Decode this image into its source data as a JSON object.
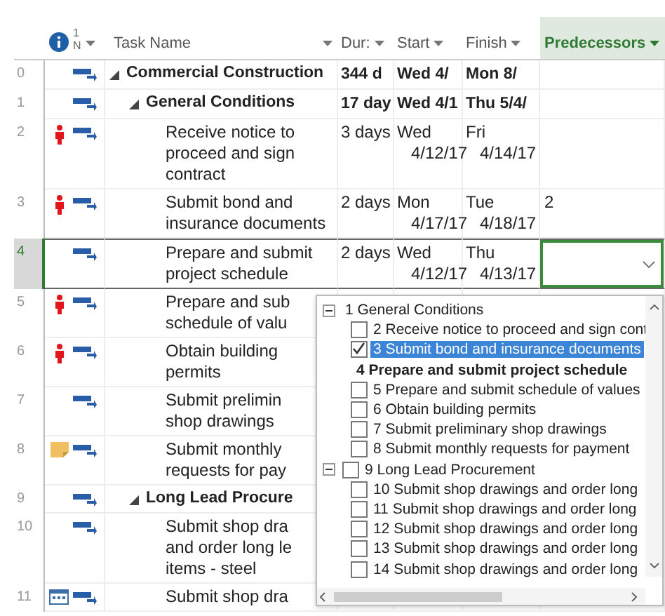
{
  "header": {
    "mode_lines": [
      "1",
      "N"
    ],
    "columns": [
      {
        "label": "Task Name",
        "selected": false
      },
      {
        "label": "Dur:",
        "selected": false
      },
      {
        "label": "Start",
        "selected": false
      },
      {
        "label": "Finish",
        "selected": false
      },
      {
        "label": "Predecessors",
        "selected": true
      }
    ]
  },
  "rows": [
    {
      "id": "0",
      "summary": true,
      "expanded": true,
      "selected": false,
      "name": [
        "Commercial Construction"
      ],
      "duration": [
        "344 d"
      ],
      "start": [
        "Wed 4/"
      ],
      "finish": [
        "Mon 8/"
      ],
      "children": [
        {
          "id": "1",
          "summary": true,
          "expanded": true,
          "selected": false,
          "name": [
            "General Conditions"
          ],
          "duration": [
            "17 day"
          ],
          "start": [
            "Wed 4/1"
          ],
          "finish": [
            "Thu 5/4/"
          ],
          "children": [
            {
              "id": "2",
              "kind": "person",
              "summary": false,
              "selected": false,
              "name": [
                "Receive notice to",
                "proceed and sign",
                "contract"
              ],
              "duration": [
                "3 days"
              ],
              "start": [
                "Wed",
                "4/12/17"
              ],
              "finish": [
                "Fri",
                "4/14/17"
              ]
            },
            {
              "id": "3",
              "kind": "person",
              "summary": false,
              "selected": false,
              "name": [
                "Submit bond and",
                "insurance documents"
              ],
              "duration": [
                "2 days"
              ],
              "start": [
                "Mon",
                "4/17/17"
              ],
              "finish": [
                "Tue",
                "4/18/17"
              ],
              "predecessors": "2"
            },
            {
              "id": "4",
              "summary": false,
              "selected": true,
              "name": [
                "Prepare and submit",
                "project schedule"
              ],
              "duration": [
                "2 days"
              ],
              "start": [
                "Wed",
                "4/12/17"
              ],
              "finish": [
                "Thu",
                "4/13/17"
              ]
            },
            {
              "id": "5",
              "kind": "person",
              "summary": false,
              "selected": false,
              "name": [
                "Prepare and sub",
                "schedule of valu"
              ]
            },
            {
              "id": "6",
              "kind": "person",
              "summary": false,
              "selected": false,
              "name": [
                "Obtain building",
                "permits"
              ]
            },
            {
              "id": "7",
              "summary": false,
              "selected": false,
              "name": [
                "Submit prelimin",
                "shop drawings"
              ]
            },
            {
              "id": "8",
              "kind": "note",
              "summary": false,
              "selected": false,
              "name": [
                "Submit monthly",
                "requests for pay"
              ]
            }
          ]
        },
        {
          "id": "9",
          "summary": true,
          "expanded": true,
          "selected": false,
          "name": [
            "Long Lead Procure"
          ],
          "children": [
            {
              "id": "10",
              "summary": false,
              "selected": false,
              "name": [
                "Submit shop dra",
                "and order long le",
                "items - steel"
              ]
            },
            {
              "id": "11",
              "kind": "calendar",
              "summary": false,
              "selected": false,
              "name": [
                "Submit shop dra"
              ]
            }
          ]
        }
      ]
    }
  ],
  "dropdown": {
    "items": [
      {
        "kind": "group",
        "text": "1 General Conditions",
        "expanded": true,
        "children": [
          {
            "kind": "checkbox",
            "text": "2 Receive notice to proceed and sign cont",
            "checked": false,
            "selected": false
          },
          {
            "kind": "checkbox",
            "text": "3 Submit bond and insurance documents",
            "checked": true,
            "selected": true
          },
          {
            "kind": "current",
            "text": "4 Prepare and submit project schedule"
          },
          {
            "kind": "checkbox",
            "text": "5 Prepare and submit schedule of values",
            "checked": false,
            "selected": false
          },
          {
            "kind": "checkbox",
            "text": "6 Obtain building permits",
            "checked": false,
            "selected": false
          },
          {
            "kind": "checkbox",
            "text": "7 Submit preliminary shop drawings",
            "checked": false,
            "selected": false
          },
          {
            "kind": "checkbox",
            "text": "8 Submit monthly requests for payment",
            "checked": false,
            "selected": false
          }
        ]
      },
      {
        "kind": "checkgroup",
        "text": "9 Long Lead Procurement",
        "expanded": true,
        "checked": false,
        "children": [
          {
            "kind": "checkbox",
            "text": "10 Submit shop drawings and order long",
            "checked": false,
            "selected": false
          },
          {
            "kind": "checkbox",
            "text": "11 Submit shop drawings and order long",
            "checked": false,
            "selected": false
          },
          {
            "kind": "checkbox",
            "text": "12 Submit shop drawings and order long",
            "checked": false,
            "selected": false
          },
          {
            "kind": "checkbox",
            "text": "13 Submit shop drawings and order long",
            "checked": false,
            "selected": false
          },
          {
            "kind": "checkbox",
            "text": "14 Submit shop drawings and order long",
            "checked": false,
            "selected": false
          }
        ]
      }
    ]
  }
}
